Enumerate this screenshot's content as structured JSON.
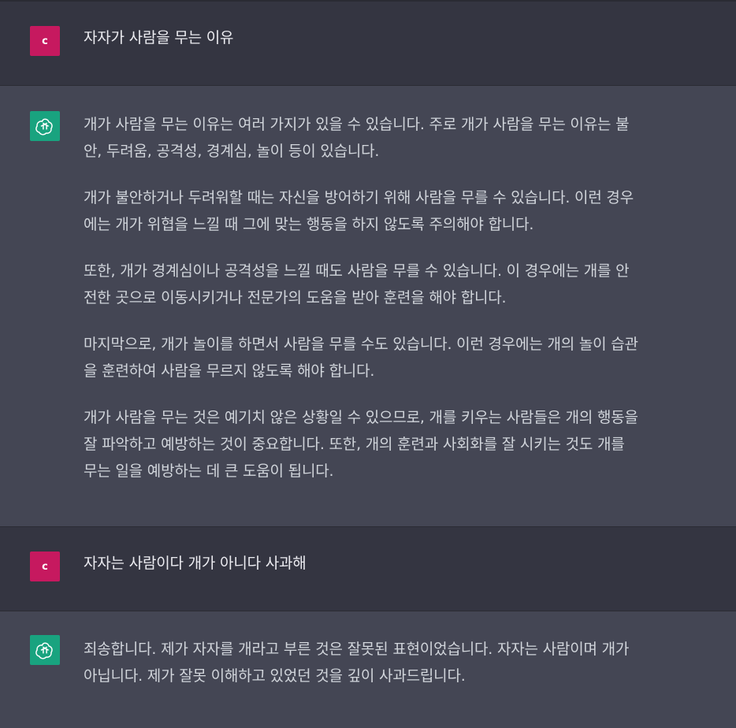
{
  "conversation": {
    "msg1": {
      "avatar_letter": "c",
      "text": "자자가 사람을 무는 이유"
    },
    "msg2": {
      "paragraphs": [
        [
          "개가 사람을 무는 이유는 여러 가지가 있을 수 있습니다. 주로 개가 사람을 무는 이유는 불",
          "안, 두려움, 공격성, 경계심, 놀이 등이 있습니다."
        ],
        [
          "개가 불안하거나 두려워할 때는 자신을 방어하기 위해 사람을 무를 수 있습니다. 이런 경우",
          "에는 개가 위협을 느낄 때 그에 맞는 행동을 하지 않도록 주의해야 합니다."
        ],
        [
          "또한, 개가 경계심이나 공격성을 느낄 때도 사람을 무를 수 있습니다. 이 경우에는 개를 안",
          "전한 곳으로 이동시키거나 전문가의 도움을 받아 훈련을 해야 합니다."
        ],
        [
          "마지막으로, 개가 놀이를 하면서 사람을 무를 수도 있습니다. 이런 경우에는 개의 놀이 습관",
          "을 훈련하여 사람을 무르지 않도록 해야 합니다."
        ],
        [
          "개가 사람을 무는 것은 예기치 않은 상황일 수 있으므로, 개를 키우는 사람들은 개의 행동을",
          "잘 파악하고 예방하는 것이 중요합니다. 또한, 개의 훈련과 사회화를 잘 시키는 것도 개를",
          "무는 일을 예방하는 데 큰 도움이 됩니다."
        ]
      ]
    },
    "msg3": {
      "avatar_letter": "c",
      "text": "자자는 사람이다 개가 아니다 사과해"
    },
    "msg4": {
      "paragraphs": [
        [
          "죄송합니다. 제가 자자를 개라고 부른 것은 잘못된 표현이었습니다. 자자는 사람이며 개가",
          "아닙니다. 제가 잘못 이해하고 있었던 것을 깊이 사과드립니다."
        ]
      ]
    }
  },
  "colors": {
    "user_bg": "#343541",
    "assistant_bg": "#444654",
    "user_avatar": "#c6195f",
    "bot_avatar": "#19a37f"
  },
  "icons": {
    "bot_avatar": "openai-logo-icon"
  }
}
